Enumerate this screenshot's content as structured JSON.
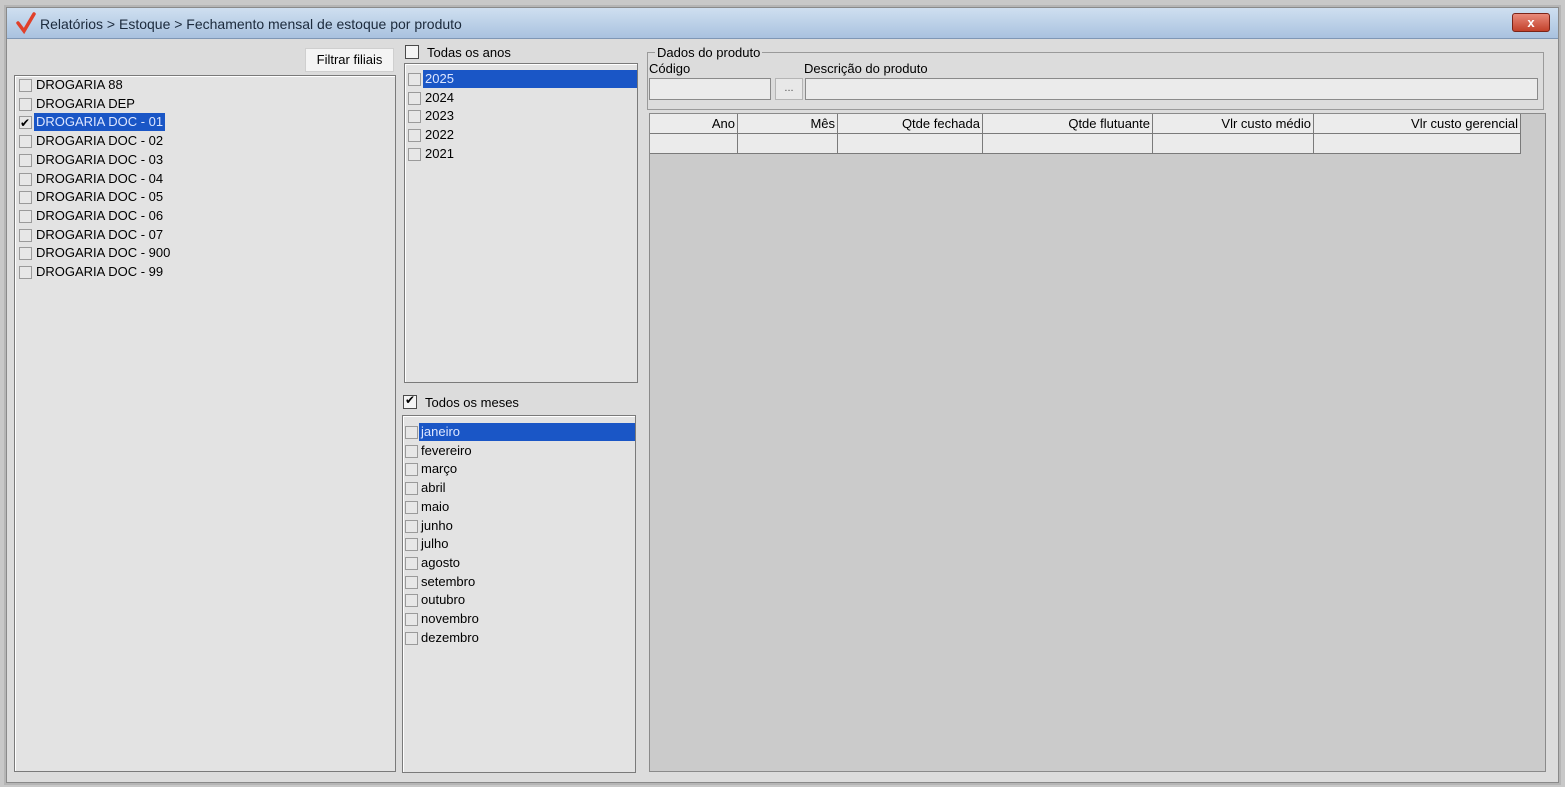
{
  "window": {
    "title": "Relatórios > Estoque > Fechamento mensal de estoque por produto",
    "close_label": "x"
  },
  "filter_button_label": "Filtrar filiais",
  "branches": [
    {
      "label": "DROGARIA 88",
      "checked": false,
      "selected": false
    },
    {
      "label": "DROGARIA DEP",
      "checked": false,
      "selected": false
    },
    {
      "label": "DROGARIA DOC - 01",
      "checked": true,
      "selected": true
    },
    {
      "label": "DROGARIA DOC - 02",
      "checked": false,
      "selected": false
    },
    {
      "label": "DROGARIA DOC - 03",
      "checked": false,
      "selected": false
    },
    {
      "label": "DROGARIA DOC - 04",
      "checked": false,
      "selected": false
    },
    {
      "label": "DROGARIA DOC - 05",
      "checked": false,
      "selected": false
    },
    {
      "label": "DROGARIA DOC - 06",
      "checked": false,
      "selected": false
    },
    {
      "label": "DROGARIA DOC - 07",
      "checked": false,
      "selected": false
    },
    {
      "label": "DROGARIA DOC - 900",
      "checked": false,
      "selected": false
    },
    {
      "label": "DROGARIA DOC - 99",
      "checked": false,
      "selected": false
    }
  ],
  "years": {
    "all_label": "Todas os anos",
    "all_checked": false,
    "items": [
      {
        "label": "2025",
        "checked": false,
        "selected": true
      },
      {
        "label": "2024",
        "checked": false,
        "selected": false
      },
      {
        "label": "2023",
        "checked": false,
        "selected": false
      },
      {
        "label": "2022",
        "checked": false,
        "selected": false
      },
      {
        "label": "2021",
        "checked": false,
        "selected": false
      }
    ]
  },
  "months": {
    "all_label": "Todos os meses",
    "all_checked": true,
    "items": [
      {
        "label": "janeiro",
        "checked": false,
        "selected": true
      },
      {
        "label": "fevereiro",
        "checked": false,
        "selected": false
      },
      {
        "label": "março",
        "checked": false,
        "selected": false
      },
      {
        "label": "abril",
        "checked": false,
        "selected": false
      },
      {
        "label": "maio",
        "checked": false,
        "selected": false
      },
      {
        "label": "junho",
        "checked": false,
        "selected": false
      },
      {
        "label": "julho",
        "checked": false,
        "selected": false
      },
      {
        "label": "agosto",
        "checked": false,
        "selected": false
      },
      {
        "label": "setembro",
        "checked": false,
        "selected": false
      },
      {
        "label": "outubro",
        "checked": false,
        "selected": false
      },
      {
        "label": "novembro",
        "checked": false,
        "selected": false
      },
      {
        "label": "dezembro",
        "checked": false,
        "selected": false
      }
    ]
  },
  "product": {
    "group_label": "Dados do produto",
    "code_label": "Código",
    "code_value": "",
    "lookup_label": "...",
    "description_label": "Descrição do produto",
    "description_value": ""
  },
  "grid": {
    "columns": [
      "Ano",
      "Mês",
      "Qtde fechada",
      "Qtde flutuante",
      "Vlr custo médio",
      "Vlr custo gerencial"
    ],
    "rows": [
      [
        "",
        "",
        "",
        "",
        "",
        ""
      ]
    ]
  },
  "colors": {
    "selection": "#1a56c6",
    "titlebar": "#a9c2df",
    "close": "#c2412b"
  },
  "icons": {
    "app": "checkmark-logo-icon",
    "close": "close-icon"
  }
}
